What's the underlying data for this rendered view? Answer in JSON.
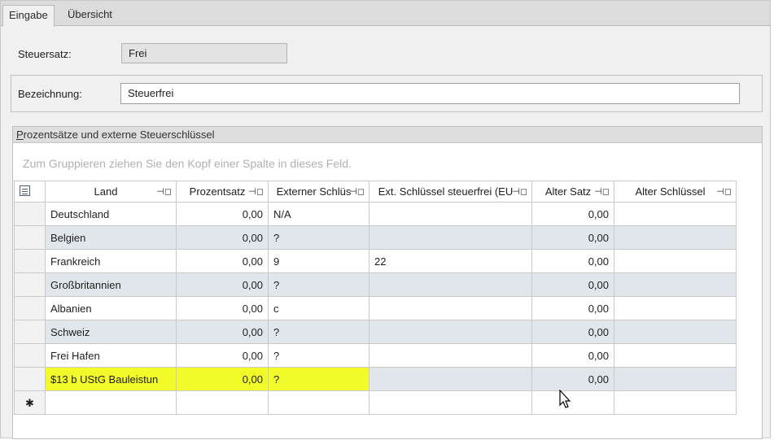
{
  "tabs": [
    {
      "label": "Eingabe",
      "active": true
    },
    {
      "label": "Übersicht",
      "active": false
    }
  ],
  "fields": {
    "steuersatz_label": "Steuersatz:",
    "steuersatz_value": "Frei",
    "bezeichnung_label": "Bezeichnung:",
    "bezeichnung_value": "Steuerfrei"
  },
  "panel": {
    "title_underlined": "P",
    "title_rest": "rozentsätze und externe Steuerschlüssel",
    "group_hint": "Zum Gruppieren ziehen Sie den Kopf einer Spalte in dieses Feld."
  },
  "grid": {
    "columns": [
      "Land",
      "Prozentsatz",
      "Externer Schlüs",
      "Ext. Schlüssel steuerfrei (EU",
      "Alter Satz",
      "Alter Schlüssel"
    ],
    "rows": [
      {
        "land": "Deutschland",
        "prozentsatz": "0,00",
        "extern": "N/A",
        "ext_eu": "",
        "alter_satz": "0,00",
        "alter_schluessel": ""
      },
      {
        "land": "Belgien",
        "prozentsatz": "0,00",
        "extern": "?",
        "ext_eu": "",
        "alter_satz": "0,00",
        "alter_schluessel": ""
      },
      {
        "land": "Frankreich",
        "prozentsatz": "0,00",
        "extern": "9",
        "ext_eu": "22",
        "alter_satz": "0,00",
        "alter_schluessel": ""
      },
      {
        "land": "Großbritannien",
        "prozentsatz": "0,00",
        "extern": "?",
        "ext_eu": "",
        "alter_satz": "0,00",
        "alter_schluessel": ""
      },
      {
        "land": "Albanien",
        "prozentsatz": "0,00",
        "extern": "c",
        "ext_eu": "",
        "alter_satz": "0,00",
        "alter_schluessel": ""
      },
      {
        "land": "Schweiz",
        "prozentsatz": "0,00",
        "extern": "?",
        "ext_eu": "",
        "alter_satz": "0,00",
        "alter_schluessel": ""
      },
      {
        "land": "Frei Hafen",
        "prozentsatz": "0,00",
        "extern": "?",
        "ext_eu": "",
        "alter_satz": "0,00",
        "alter_schluessel": ""
      },
      {
        "land": "$13 b UStG Bauleistun",
        "prozentsatz": "0,00",
        "extern": "?",
        "ext_eu": "",
        "alter_satz": "0,00",
        "alter_schluessel": "",
        "highlighted": true
      }
    ],
    "new_row_marker": "✱"
  },
  "icons": {
    "column_chooser": "column-chooser-icon",
    "pin": "pin-icon",
    "cursor": "mouse-cursor-icon"
  },
  "colors": {
    "highlight": "#f3fa29",
    "alt_row": "#e1e6ec"
  }
}
